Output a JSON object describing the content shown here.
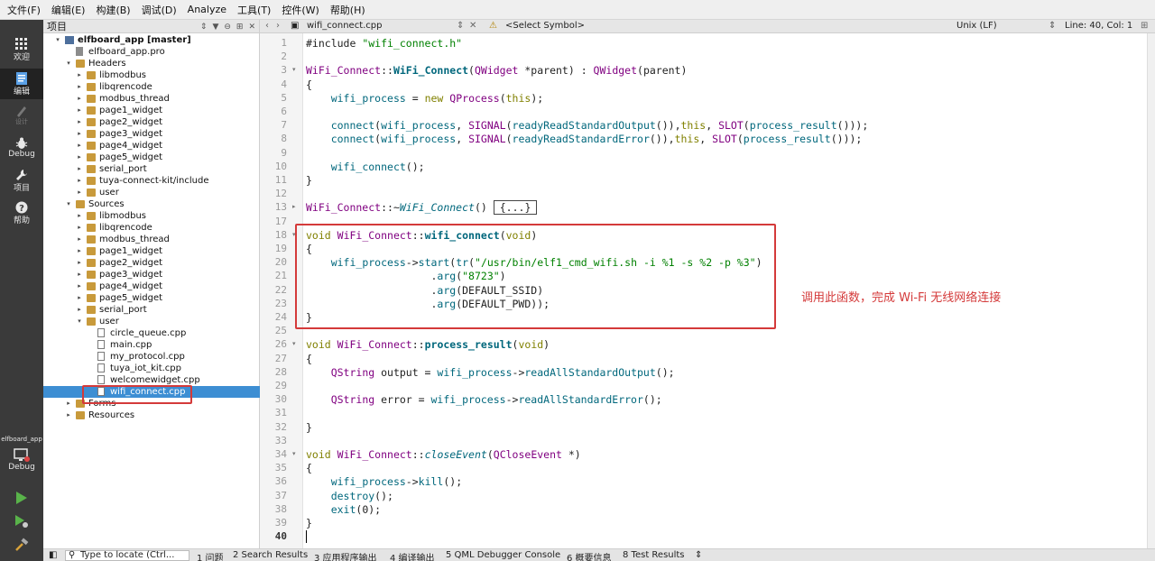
{
  "menu": [
    "文件(F)",
    "编辑(E)",
    "构建(B)",
    "调试(D)",
    "Analyze",
    "工具(T)",
    "控件(W)",
    "帮助(H)"
  ],
  "modes": [
    {
      "label": "欢迎",
      "icon": "grid-icon"
    },
    {
      "label": "编辑",
      "icon": "edit-doc-icon"
    },
    {
      "label": "设计",
      "icon": "pen-icon"
    },
    {
      "label": "Debug",
      "icon": "bug-icon"
    },
    {
      "label": "项目",
      "icon": "wrench-icon"
    },
    {
      "label": "帮助",
      "icon": "help-icon"
    }
  ],
  "kit": {
    "project": "elfboard_app",
    "mode": "Debug"
  },
  "sidebar": {
    "title": "项目",
    "tree": [
      {
        "label": "elfboard_app [master]",
        "indent": 0,
        "arrow": "▾",
        "icon": "proj",
        "bold": true
      },
      {
        "label": "elfboard_app.pro",
        "indent": 1,
        "arrow": "",
        "icon": "pro"
      },
      {
        "label": "Headers",
        "indent": 1,
        "arrow": "▾",
        "icon": "folder"
      },
      {
        "label": "libmodbus",
        "indent": 2,
        "arrow": "▸",
        "icon": "folder"
      },
      {
        "label": "libqrencode",
        "indent": 2,
        "arrow": "▸",
        "icon": "folder"
      },
      {
        "label": "modbus_thread",
        "indent": 2,
        "arrow": "▸",
        "icon": "folder"
      },
      {
        "label": "page1_widget",
        "indent": 2,
        "arrow": "▸",
        "icon": "folder"
      },
      {
        "label": "page2_widget",
        "indent": 2,
        "arrow": "▸",
        "icon": "folder"
      },
      {
        "label": "page3_widget",
        "indent": 2,
        "arrow": "▸",
        "icon": "folder"
      },
      {
        "label": "page4_widget",
        "indent": 2,
        "arrow": "▸",
        "icon": "folder"
      },
      {
        "label": "page5_widget",
        "indent": 2,
        "arrow": "▸",
        "icon": "folder"
      },
      {
        "label": "serial_port",
        "indent": 2,
        "arrow": "▸",
        "icon": "folder"
      },
      {
        "label": "tuya-connect-kit/include",
        "indent": 2,
        "arrow": "▸",
        "icon": "folder"
      },
      {
        "label": "user",
        "indent": 2,
        "arrow": "▸",
        "icon": "folder"
      },
      {
        "label": "Sources",
        "indent": 1,
        "arrow": "▾",
        "icon": "folder"
      },
      {
        "label": "libmodbus",
        "indent": 2,
        "arrow": "▸",
        "icon": "folder"
      },
      {
        "label": "libqrencode",
        "indent": 2,
        "arrow": "▸",
        "icon": "folder"
      },
      {
        "label": "modbus_thread",
        "indent": 2,
        "arrow": "▸",
        "icon": "folder"
      },
      {
        "label": "page1_widget",
        "indent": 2,
        "arrow": "▸",
        "icon": "folder"
      },
      {
        "label": "page2_widget",
        "indent": 2,
        "arrow": "▸",
        "icon": "folder"
      },
      {
        "label": "page3_widget",
        "indent": 2,
        "arrow": "▸",
        "icon": "folder"
      },
      {
        "label": "page4_widget",
        "indent": 2,
        "arrow": "▸",
        "icon": "folder"
      },
      {
        "label": "page5_widget",
        "indent": 2,
        "arrow": "▸",
        "icon": "folder"
      },
      {
        "label": "serial_port",
        "indent": 2,
        "arrow": "▸",
        "icon": "folder"
      },
      {
        "label": "user",
        "indent": 2,
        "arrow": "▾",
        "icon": "folder"
      },
      {
        "label": "circle_queue.cpp",
        "indent": 3,
        "arrow": "",
        "icon": "cpp"
      },
      {
        "label": "main.cpp",
        "indent": 3,
        "arrow": "",
        "icon": "cpp"
      },
      {
        "label": "my_protocol.cpp",
        "indent": 3,
        "arrow": "",
        "icon": "cpp"
      },
      {
        "label": "tuya_iot_kit.cpp",
        "indent": 3,
        "arrow": "",
        "icon": "cpp"
      },
      {
        "label": "welcomewidget.cpp",
        "indent": 3,
        "arrow": "",
        "icon": "cpp"
      },
      {
        "label": "wifi_connect.cpp",
        "indent": 3,
        "arrow": "",
        "icon": "cpp",
        "selected": true
      },
      {
        "label": "Forms",
        "indent": 1,
        "arrow": "▸",
        "icon": "folder"
      },
      {
        "label": "Resources",
        "indent": 1,
        "arrow": "▸",
        "icon": "folder"
      }
    ]
  },
  "editor_toolbar": {
    "file": "wifi_connect.cpp",
    "symbol": "<Select Symbol>",
    "line_ending": "Unix (LF)",
    "position": "Line: 40, Col: 1"
  },
  "code_lines": [
    {
      "n": 1,
      "html": "#include <span class=\"str\">\"wifi_connect.h\"</span>"
    },
    {
      "n": 2,
      "html": ""
    },
    {
      "n": 3,
      "html": "<span class=\"ty\">WiFi_Connect</span>::<span class=\"fnb\">WiFi_Connect</span>(<span class=\"ty\">QWidget</span> *parent) : <span class=\"ty\">QWidget</span>(parent)",
      "fold": "▾"
    },
    {
      "n": 4,
      "html": "{"
    },
    {
      "n": 5,
      "html": "    <span class=\"fn\">wifi_process</span> = <span class=\"kw\">new</span> <span class=\"ty\">QProcess</span>(<span class=\"kw\">this</span>);"
    },
    {
      "n": 6,
      "html": ""
    },
    {
      "n": 7,
      "html": "    <span class=\"fn\">connect</span>(<span class=\"fn\">wifi_process</span>, <span class=\"ty\">SIGNAL</span>(<span class=\"fn\">readyReadStandardOutput</span>()),<span class=\"kw\">this</span>, <span class=\"ty\">SLOT</span>(<span class=\"fn\">process_result</span>()));"
    },
    {
      "n": 8,
      "html": "    <span class=\"fn\">connect</span>(<span class=\"fn\">wifi_process</span>, <span class=\"ty\">SIGNAL</span>(<span class=\"fn\">readyReadStandardError</span>()),<span class=\"kw\">this</span>, <span class=\"ty\">SLOT</span>(<span class=\"fn\">process_result</span>()));"
    },
    {
      "n": 9,
      "html": ""
    },
    {
      "n": 10,
      "html": "    <span class=\"fn\">wifi_connect</span>();"
    },
    {
      "n": 11,
      "html": "}"
    },
    {
      "n": 12,
      "html": ""
    },
    {
      "n": 13,
      "html": "<span class=\"ty\">WiFi_Connect</span>::~<span class=\"it\">WiFi_Connect</span>() <span style=\"border:1px solid #444;padding:0 6px;\">{...}</span>",
      "fold": "▸"
    },
    {
      "n": 17,
      "html": ""
    },
    {
      "n": 18,
      "html": "<span class=\"kw\">void</span> <span class=\"ty\">WiFi_Connect</span>::<span class=\"fnb\">wifi_connect</span>(<span class=\"kw\">void</span>)",
      "fold": "▾"
    },
    {
      "n": 19,
      "html": "{"
    },
    {
      "n": 20,
      "html": "    <span class=\"fn\">wifi_process</span>-><span class=\"fn\">start</span>(<span class=\"fn\">tr</span>(<span class=\"str\">\"/usr/bin/elf1_cmd_wifi.sh -i %1 -s %2 -p %3\"</span>)"
    },
    {
      "n": 21,
      "html": "                    .<span class=\"fn\">arg</span>(<span class=\"str\">\"8723\"</span>)"
    },
    {
      "n": 22,
      "html": "                    .<span class=\"fn\">arg</span>(DEFAULT_SSID)"
    },
    {
      "n": 23,
      "html": "                    .<span class=\"fn\">arg</span>(DEFAULT_PWD));"
    },
    {
      "n": 24,
      "html": "}"
    },
    {
      "n": 25,
      "html": ""
    },
    {
      "n": 26,
      "html": "<span class=\"kw\">void</span> <span class=\"ty\">WiFi_Connect</span>::<span class=\"fnb\">process_result</span>(<span class=\"kw\">void</span>)",
      "fold": "▾"
    },
    {
      "n": 27,
      "html": "{"
    },
    {
      "n": 28,
      "html": "    <span class=\"ty\">QString</span> output = <span class=\"fn\">wifi_process</span>-><span class=\"fn\">readAllStandardOutput</span>();"
    },
    {
      "n": 29,
      "html": ""
    },
    {
      "n": 30,
      "html": "    <span class=\"ty\">QString</span> error = <span class=\"fn\">wifi_process</span>-><span class=\"fn\">readAllStandardError</span>();"
    },
    {
      "n": 31,
      "html": ""
    },
    {
      "n": 32,
      "html": "}"
    },
    {
      "n": 33,
      "html": ""
    },
    {
      "n": 34,
      "html": "<span class=\"kw\">void</span> <span class=\"ty\">WiFi_Connect</span>::<span class=\"it\">closeEvent</span>(<span class=\"ty\">QCloseEvent</span> *)",
      "fold": "▾"
    },
    {
      "n": 35,
      "html": "{"
    },
    {
      "n": 36,
      "html": "    <span class=\"fn\">wifi_process</span>-><span class=\"fn\">kill</span>();"
    },
    {
      "n": 37,
      "html": "    <span class=\"fn\">destroy</span>();"
    },
    {
      "n": 38,
      "html": "    <span class=\"fn\">exit</span>(0);"
    },
    {
      "n": 39,
      "html": "}"
    },
    {
      "n": 40,
      "html": "",
      "bold": true
    }
  ],
  "annotation": "调用此函数，完成 Wi-Fi 无线网络连接",
  "status": {
    "locator_placeholder": "Type to locate (Ctrl...",
    "panes": [
      "1 问题",
      "2 Search Results",
      "3 应用程序输出",
      "4 编译输出",
      "5 QML Debugger Console",
      "6 概要信息",
      "8 Test Results"
    ]
  },
  "colors": {
    "accent": "#3d8ed3",
    "highlight": "#d43a3a",
    "modebar": "#3a3a3a"
  }
}
